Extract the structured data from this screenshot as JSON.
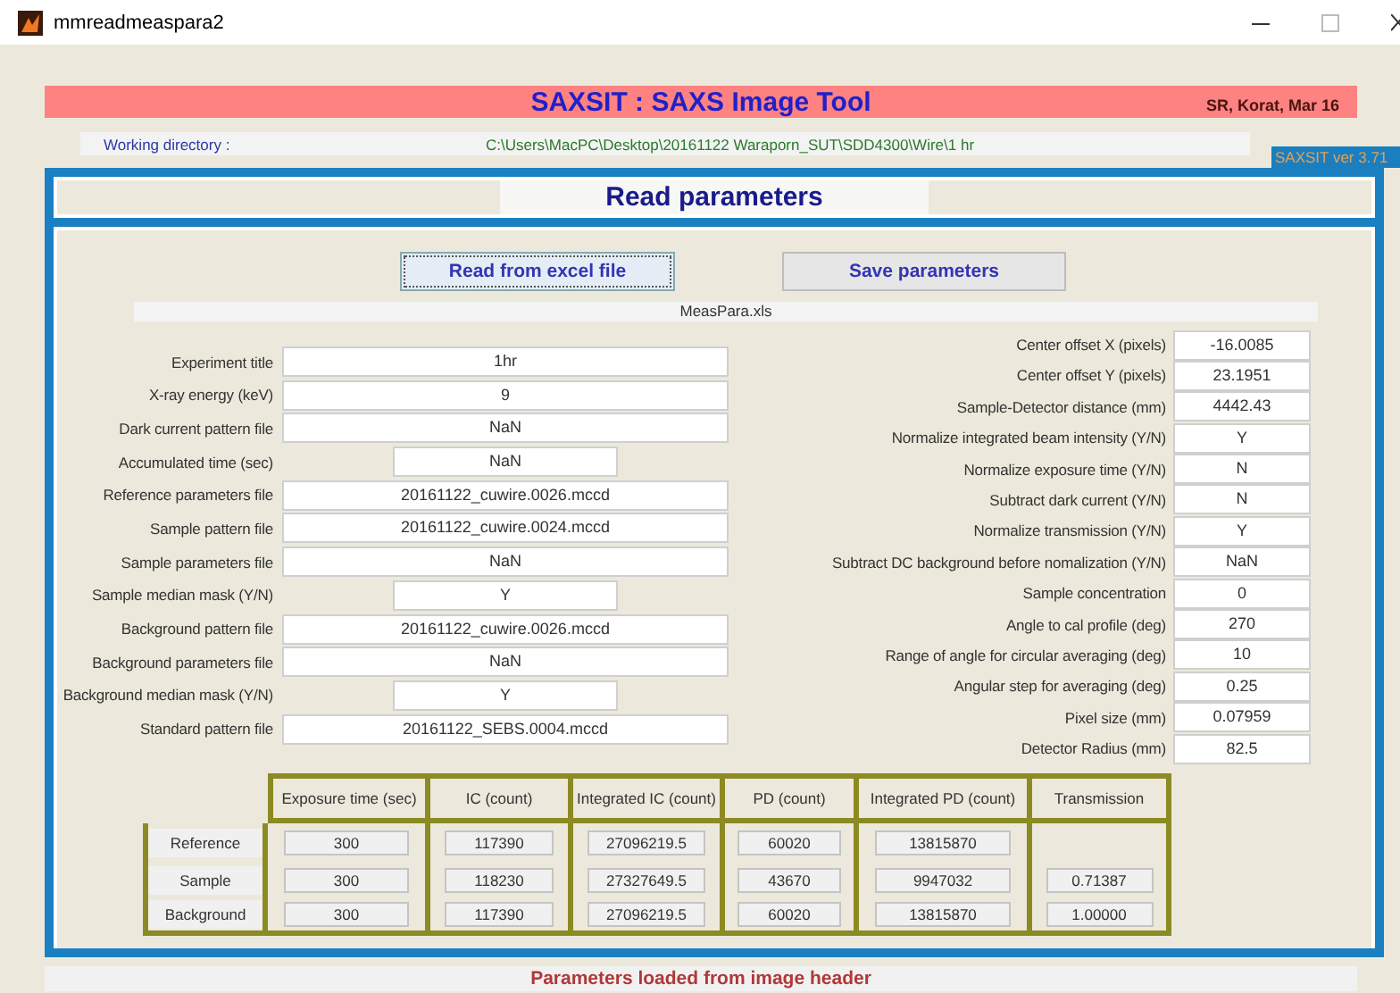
{
  "window": {
    "title": "mmreadmeaspara2"
  },
  "banner": {
    "title": "SAXSIT : SAXS Image Tool",
    "credit": "SR, Korat, Mar 16"
  },
  "working_directory": {
    "label": "Working directory :",
    "path": "C:\\Users\\MacPC\\Desktop\\20161122 Waraporn_SUT\\SDD4300\\Wire\\1 hr"
  },
  "version": "SAXSIT ver 3.71",
  "panel_title": "Read parameters",
  "buttons": [
    {
      "label": "Read from excel file",
      "focused": true
    },
    {
      "label": "Save parameters",
      "focused": false
    }
  ],
  "file_name": "MeasPara.xls",
  "left_fields": [
    {
      "label": "Experiment title",
      "value": "1hr",
      "kind": "wide"
    },
    {
      "label": "X-ray energy (keV)",
      "value": "9",
      "kind": "wide"
    },
    {
      "label": "Dark current pattern file",
      "value": "NaN",
      "kind": "wide"
    },
    {
      "label": "Accumulated time (sec)",
      "value": "NaN",
      "kind": "short"
    },
    {
      "label": "Reference parameters file",
      "value": "20161122_cuwire.0026.mccd",
      "kind": "wide"
    },
    {
      "label": "Sample pattern file",
      "value": "20161122_cuwire.0024.mccd",
      "kind": "wide"
    },
    {
      "label": "Sample parameters file",
      "value": "NaN",
      "kind": "wide"
    },
    {
      "label": "Sample median mask (Y/N)",
      "value": "Y",
      "kind": "short"
    },
    {
      "label": "Background pattern file",
      "value": "20161122_cuwire.0026.mccd",
      "kind": "wide"
    },
    {
      "label": "Background parameters file",
      "value": "NaN",
      "kind": "wide"
    },
    {
      "label": "Background median mask (Y/N)",
      "value": "Y",
      "kind": "short"
    },
    {
      "label": "Standard pattern file",
      "value": "20161122_SEBS.0004.mccd",
      "kind": "wide"
    }
  ],
  "right_fields": [
    {
      "label": "Center offset X (pixels)",
      "value": "-16.0085"
    },
    {
      "label": "Center offset Y (pixels)",
      "value": "23.1951"
    },
    {
      "label": "Sample-Detector distance (mm)",
      "value": "4442.43"
    },
    {
      "label": "Normalize integrated beam intensity (Y/N)",
      "value": "Y"
    },
    {
      "label": "Normalize exposure time (Y/N)",
      "value": "N"
    },
    {
      "label": "Subtract dark current (Y/N)",
      "value": "N"
    },
    {
      "label": "Normalize transmission (Y/N)",
      "value": "Y"
    },
    {
      "label": "Subtract DC background before nomalization (Y/N)",
      "value": "NaN"
    },
    {
      "label": "Sample concentration",
      "value": "0"
    },
    {
      "label": "Angle to cal profile (deg)",
      "value": "270"
    },
    {
      "label": "Range of angle for circular averaging (deg)",
      "value": "10"
    },
    {
      "label": "Angular step for averaging (deg)",
      "value": "0.25"
    },
    {
      "label": "Pixel size (mm)",
      "value": "0.07959"
    },
    {
      "label": "Detector Radius (mm)",
      "value": "82.5"
    }
  ],
  "table": {
    "columns": [
      "Exposure time (sec)",
      "IC (count)",
      "Integrated IC (count)",
      "PD (count)",
      "Integrated PD (count)",
      "Transmission"
    ],
    "rows": [
      {
        "name": "Reference",
        "values": [
          "300",
          "117390",
          "27096219.5",
          "60020",
          "13815870"
        ]
      },
      {
        "name": "Sample",
        "values": [
          "300",
          "118230",
          "27327649.5",
          "43670",
          "9947032",
          "0.71387"
        ]
      },
      {
        "name": "Background",
        "values": [
          "300",
          "117390",
          "27096219.5",
          "60020",
          "13815870",
          "1.00000"
        ]
      }
    ]
  },
  "status": "Parameters loaded from image header"
}
